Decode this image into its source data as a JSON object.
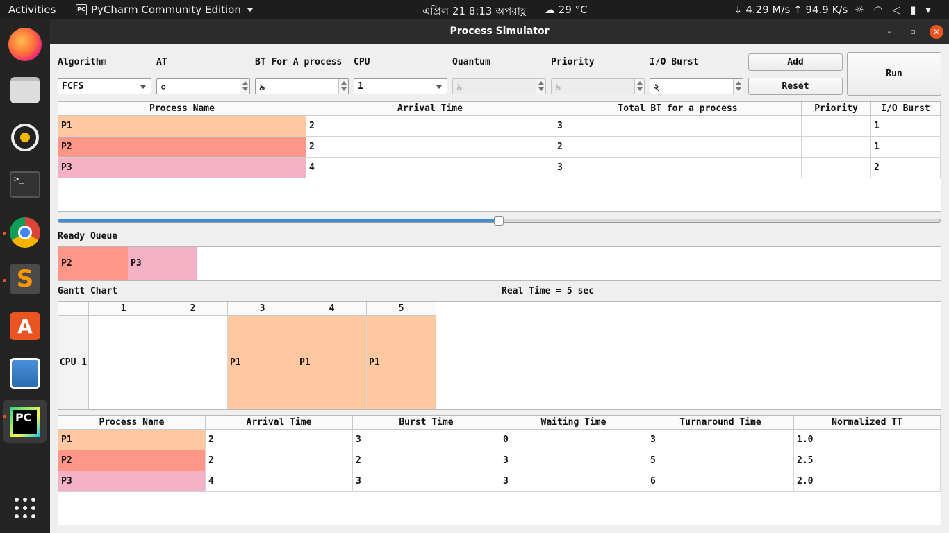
{
  "topbar": {
    "activities": "Activities",
    "app_name": "PyCharm Community Edition",
    "clock": "এপ্রিল 21  8:13 অপরাহ্ণ",
    "weather": "29 °C",
    "network": "↓ 4.29 M/s ↑ 94.9 K/s",
    "tray_icons": [
      "brightness-icon",
      "wifi-icon",
      "volume-icon",
      "battery-icon",
      "menu-caret-icon"
    ]
  },
  "dock": {
    "apps": [
      "firefox",
      "files",
      "rhythmbox",
      "terminal",
      "chrome",
      "sublime-text",
      "software-store",
      "image-viewer",
      "pycharm",
      "show-applications"
    ],
    "accent": "#e95420"
  },
  "window": {
    "title": "Process Simulator",
    "minimize": "–",
    "maximize": "▫",
    "close": "✕"
  },
  "form": {
    "algorithm": {
      "label": "Algorithm",
      "value": "FCFS"
    },
    "at": {
      "label": "AT",
      "value": "০"
    },
    "bt": {
      "label": "BT For A process",
      "value": "৯"
    },
    "cpu": {
      "label": "CPU",
      "value": "1"
    },
    "quantum": {
      "label": "Quantum",
      "value": "৯"
    },
    "priority": {
      "label": "Priority",
      "value": "৯"
    },
    "io_burst": {
      "label": "I/O Burst",
      "value": "২"
    },
    "add_label": "Add",
    "reset_label": "Reset",
    "run_label": "Run"
  },
  "process_table": {
    "headers": [
      "Process Name",
      "Arrival Time",
      "Total BT for a process",
      "Priority",
      "I/O Burst"
    ],
    "rows": [
      {
        "name": "P1",
        "arrival": "2",
        "bt": "3",
        "priority": "",
        "io": "1",
        "color": "#ffc8a0"
      },
      {
        "name": "P2",
        "arrival": "2",
        "bt": "2",
        "priority": "",
        "io": "1",
        "color": "#ff9688"
      },
      {
        "name": "P3",
        "arrival": "4",
        "bt": "3",
        "priority": "",
        "io": "2",
        "color": "#f4b0c4"
      }
    ]
  },
  "timeline": {
    "progress": 0.5,
    "fill_color": "#3d8fd6"
  },
  "ready_queue": {
    "label": "Ready Queue",
    "items": [
      {
        "name": "P2",
        "color": "#ff9688"
      },
      {
        "name": "P3",
        "color": "#f4b0c4"
      }
    ]
  },
  "gantt": {
    "label": "Gantt Chart",
    "real_time": "Real Time = 5 sec",
    "columns": [
      "1",
      "2",
      "3",
      "4",
      "5"
    ],
    "row_label": "CPU 1",
    "cells": [
      {
        "text": "",
        "color": "#ffffff"
      },
      {
        "text": "",
        "color": "#ffffff"
      },
      {
        "text": "P1",
        "color": "#ffc8a0"
      },
      {
        "text": "P1",
        "color": "#ffc8a0"
      },
      {
        "text": "P1",
        "color": "#ffc8a0"
      }
    ]
  },
  "results_table": {
    "headers": [
      "Process Name",
      "Arrival Time",
      "Burst Time",
      "Waiting Time",
      "Turnaround Time",
      "Normalized TT"
    ],
    "rows": [
      {
        "name": "P1",
        "arrival": "2",
        "burst": "3",
        "waiting": "0",
        "turnaround": "3",
        "ntt": "1.0",
        "color": "#ffc8a0"
      },
      {
        "name": "P2",
        "arrival": "2",
        "burst": "2",
        "waiting": "3",
        "turnaround": "5",
        "ntt": "2.5",
        "color": "#ff9688"
      },
      {
        "name": "P3",
        "arrival": "4",
        "burst": "3",
        "waiting": "3",
        "turnaround": "6",
        "ntt": "2.0",
        "color": "#f4b0c4"
      }
    ]
  }
}
